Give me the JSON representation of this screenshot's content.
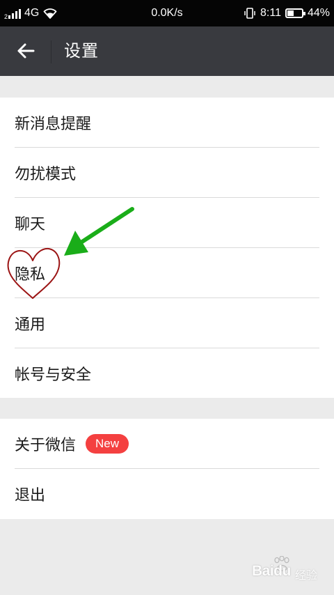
{
  "status_bar": {
    "sim_slot": "2",
    "network": "4G",
    "speed": "0.0K/s",
    "time": "8:11",
    "battery": "44%",
    "battery_level": 0.44
  },
  "header": {
    "title": "设置"
  },
  "groups": [
    {
      "items": [
        {
          "label": "新消息提醒"
        },
        {
          "label": "勿扰模式"
        },
        {
          "label": "聊天"
        },
        {
          "label": "隐私"
        },
        {
          "label": "通用"
        },
        {
          "label": "帐号与安全"
        }
      ]
    },
    {
      "items": [
        {
          "label": "关于微信",
          "badge": "New"
        },
        {
          "label": "退出"
        }
      ]
    }
  ],
  "watermark": {
    "brand": "Baidu",
    "sub": "经验"
  },
  "colors": {
    "status_bar_bg": "#050505",
    "header_bg": "#393a3f",
    "badge_bg": "#f44040",
    "arrow": "#1aad19",
    "heart": "#9b1414"
  }
}
